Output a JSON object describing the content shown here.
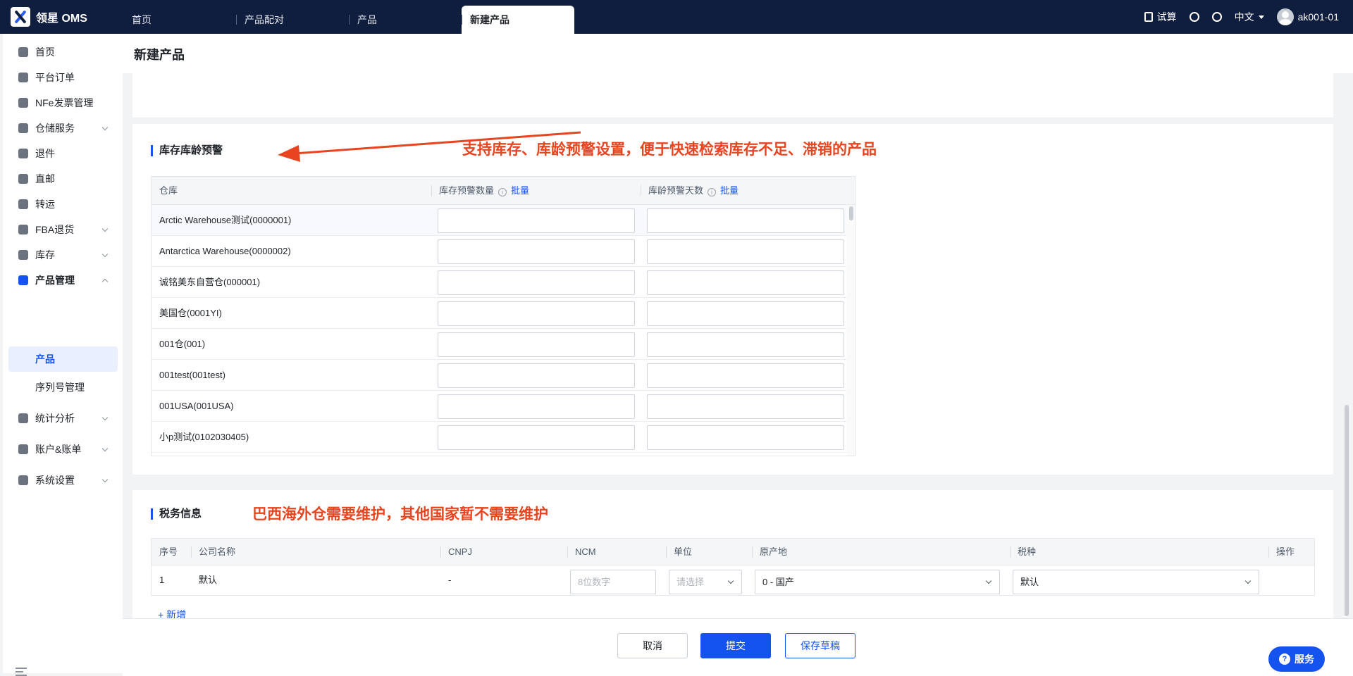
{
  "app": {
    "logo": "领星 OMS"
  },
  "tabs": [
    "首页",
    "产品配对",
    "产品",
    "新建产品"
  ],
  "topbar": {
    "calc": "试算",
    "lang": "中文",
    "user": "ak001-01"
  },
  "sidebar": {
    "items": [
      "首页",
      "平台订单",
      "NFe发票管理",
      "仓储服务",
      "退件",
      "直邮",
      "转运",
      "FBA退货",
      "库存",
      "产品管理",
      "统计分析",
      "账户&账单",
      "系统设置"
    ],
    "subitems": [
      "产品",
      "序列号管理"
    ]
  },
  "page": {
    "title": "新建产品"
  },
  "inventory": {
    "title": "库存库龄预警",
    "annotation": "支持库存、库龄预警设置，便于快速检索库存不足、滞销的产品",
    "columns": [
      "仓库",
      "库存预警数量",
      "库龄预警天数"
    ],
    "info_glyph": "i",
    "batch": "批量",
    "warehouses": [
      "Arctic Warehouse测试(0000001)",
      "Antarctica Warehouse(0000002)",
      "诚铭美东自营仓(000001)",
      "美国仓(0001YI)",
      "001仓(001)",
      "001test(001test)",
      "001USA(001USA)",
      "小p测试(0102030405)"
    ]
  },
  "tax": {
    "title": "税务信息",
    "annotation": "巴西海外仓需要维护，其他国家暂不需要维护",
    "columns": [
      "序号",
      "公司名称",
      "CNPJ",
      "NCM",
      "单位",
      "原产地",
      "税种",
      "操作"
    ],
    "row": {
      "index": "1",
      "company": "默认",
      "cnpj": "-",
      "ncm_placeholder": "8位数字",
      "unit_placeholder": "请选择",
      "origin": "0 - 国产",
      "tax_type": "默认"
    },
    "add": "新增",
    "add_glyph": "+"
  },
  "footer": {
    "cancel": "取消",
    "submit": "提交",
    "draft": "保存草稿"
  },
  "service": {
    "label": "服务",
    "glyph": "?"
  }
}
